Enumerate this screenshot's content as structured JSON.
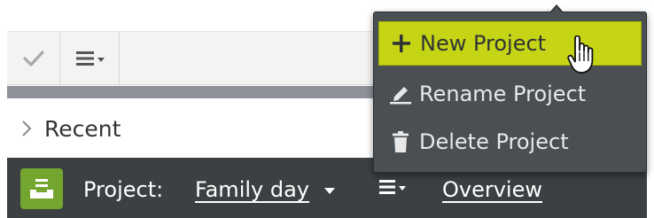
{
  "toolbar": {
    "check_icon": "checkmark-icon",
    "list_icon": "list-menu-icon"
  },
  "recent": {
    "label": "Recent",
    "chevron_icon": "chevron-right-icon"
  },
  "footer": {
    "logo_icon": "inbox-tray-icon",
    "project_label": "Project:",
    "project_name": "Family day",
    "list_icon": "list-menu-icon",
    "overview_link": "Overview"
  },
  "menu": {
    "items": [
      {
        "label": "New Project",
        "icon": "plus-icon",
        "highlighted": true
      },
      {
        "label": "Rename Project",
        "icon": "pencil-icon",
        "highlighted": false
      },
      {
        "label": "Delete Project",
        "icon": "trash-icon",
        "highlighted": false
      }
    ]
  },
  "colors": {
    "highlight": "#c5d415",
    "menu_bg": "#4a4f53",
    "bottom_bar": "#3c4042",
    "logo_green": "#74a52e",
    "toolbar_bg": "#f3f3f3"
  },
  "cursor": "hand-pointer-cursor"
}
